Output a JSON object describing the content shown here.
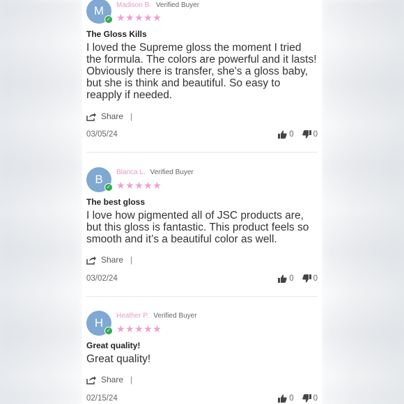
{
  "reviews": [
    {
      "avatar_letter": "M",
      "author": "Madison B.",
      "verified": "Verified Buyer",
      "stars": "★★★★★",
      "rating": 5,
      "title": "The Gloss Kills",
      "body": "I loved the Supreme gloss the moment I tried the formula. The colors are powerful and it lasts! Obviously there is transfer, she's a gloss baby, but she is think and beautiful. So easy to reapply if needed.",
      "share": "Share",
      "separator": "|",
      "date": "03/05/24",
      "helpful": "0",
      "unhelpful": "0"
    },
    {
      "avatar_letter": "B",
      "author": "Blanca L.",
      "verified": "Verified Buyer",
      "stars": "★★★★★",
      "rating": 5,
      "title": "The best gloss",
      "body": "I love how pigmented all of JSC products are, but this gloss is fantastic. This product feels so smooth and it’s a beautiful color as well.",
      "share": "Share",
      "separator": "|",
      "date": "03/02/24",
      "helpful": "0",
      "unhelpful": "0"
    },
    {
      "avatar_letter": "H",
      "author": "Heather P.",
      "verified": "Verified Buyer",
      "stars": "★★★★★",
      "rating": 5,
      "title": "Great quality!",
      "body": "Great quality!",
      "share": "Share",
      "separator": "|",
      "date": "02/15/24",
      "helpful": "0",
      "unhelpful": "0"
    }
  ],
  "colors": {
    "avatar": "#7fa8d3",
    "verified_badge": "#32a852",
    "author_name": "#e59ac8",
    "stars": "#ef9fd2"
  },
  "icons": {
    "share": "share-icon",
    "thumbs_up": "thumbs-up-icon",
    "thumbs_down": "thumbs-down-icon",
    "verified": "checkmark-icon"
  }
}
